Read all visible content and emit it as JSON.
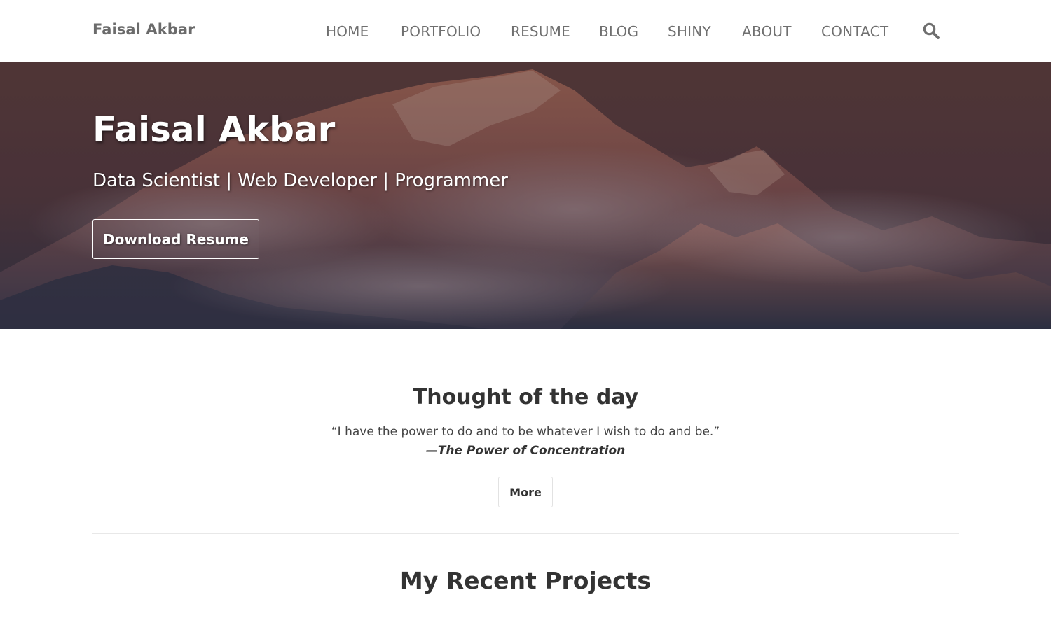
{
  "navbar": {
    "brand": "Faisal Akbar",
    "links": [
      "HOME",
      "PORTFOLIO",
      "RESUME",
      "BLOG",
      "SHINY",
      "ABOUT",
      "CONTACT"
    ],
    "search_icon": "search-icon"
  },
  "hero": {
    "title": "Faisal Akbar",
    "subtitle": "Data Scientist | Web Developer | Programmer",
    "button_label": "Download Resume"
  },
  "thought": {
    "title": "Thought of the day",
    "quote": "“I have the power to do and to be whatever I wish to do and be.”",
    "source": "—The Power of Concentration",
    "more_label": "More"
  },
  "projects": {
    "title": "My Recent Projects"
  },
  "colors": {
    "nav_text": "#6f6f6f",
    "heading_text": "#333333",
    "hero_overlay": "#553a3c"
  }
}
